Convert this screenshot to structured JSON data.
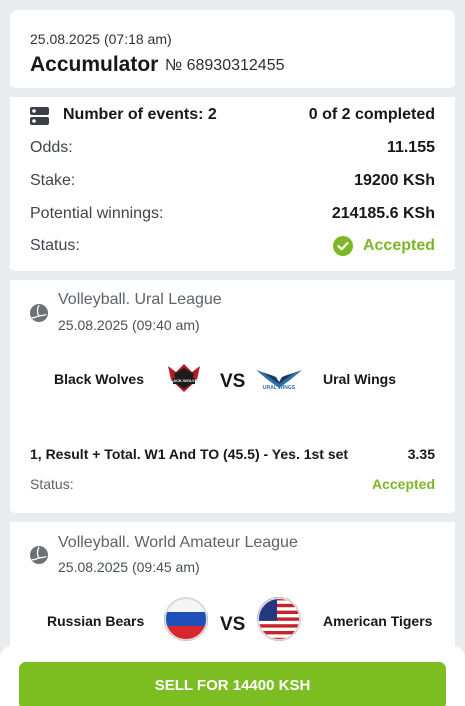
{
  "header": {
    "date": "25.08.2025 (07:18 am)",
    "title": "Accumulator",
    "bet_number": "№ 68930312455"
  },
  "summary": {
    "events_label": "Number of events: 2",
    "completed": "0 of 2 completed",
    "odds_label": "Odds:",
    "odds_value": "11.155",
    "stake_label": "Stake:",
    "stake_value": "19200 KSh",
    "winnings_label": "Potential winnings:",
    "winnings_value": "214185.6 KSh",
    "status_label": "Status:",
    "status_value": "Accepted",
    "status_color": "#7cb728"
  },
  "events": [
    {
      "league": "Volleyball. Ural League",
      "date": "25.08.2025 (09:40 am)",
      "team1": "Black Wolves",
      "vs": "VS",
      "team2": "Ural Wings",
      "team1_logo_text": "BLACK WOLVES",
      "team2_logo_text": "URAL WINGS",
      "market": "1, Result + Total. W1 And TO (45.5) - Yes. 1st set",
      "coef": "3.35",
      "status_label": "Status:",
      "status_value": "Accepted"
    },
    {
      "league": "Volleyball. World Amateur League",
      "date": "25.08.2025 (09:45 am)",
      "team1": "Russian Bears",
      "vs": "VS",
      "team2": "American Tigers",
      "team1_logo": "russia-flag-icon",
      "team2_logo": "usa-flag-icon"
    }
  ],
  "footer": {
    "sell_label": "SELL FOR 14400 KSH",
    "button_color": "#7cbd22"
  }
}
